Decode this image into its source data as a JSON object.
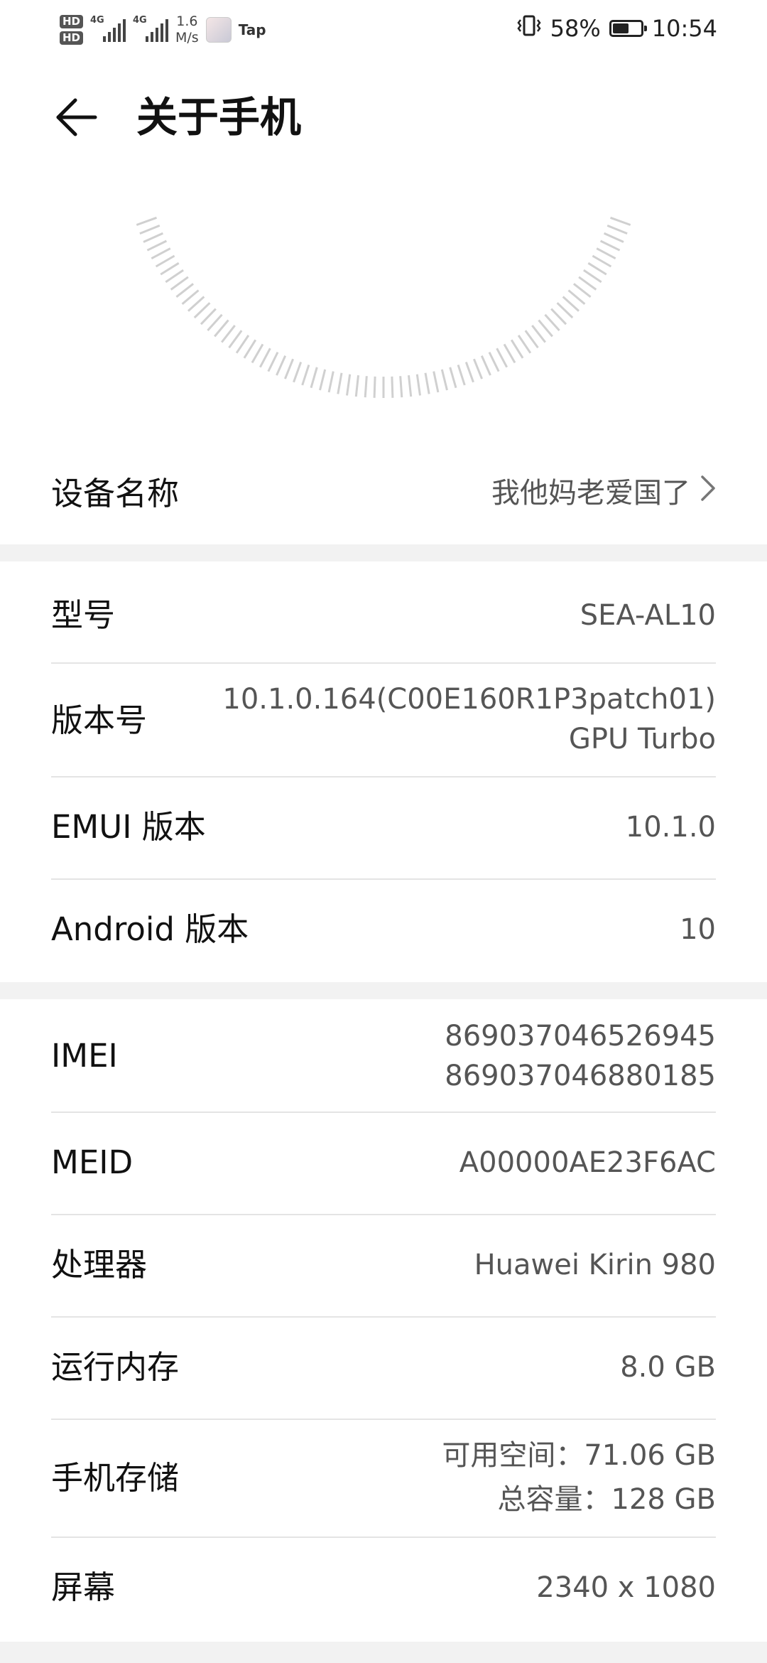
{
  "status": {
    "hd1": "HD",
    "hd2": "HD",
    "net1": "4G",
    "net2": "4G",
    "speed_value": "1.6",
    "speed_unit": "M/s",
    "app_label": "Tap",
    "battery_percent_text": "58%",
    "battery_level": 58,
    "time": "10:54"
  },
  "header": {
    "title": "关于手机"
  },
  "device_name": {
    "label": "设备名称",
    "value": "我他妈老爱国了"
  },
  "section1": [
    {
      "label": "型号",
      "lines": [
        "SEA-AL10"
      ]
    },
    {
      "label": "版本号",
      "lines": [
        "10.1.0.164(C00E160R1P3patch01)",
        "GPU Turbo"
      ]
    },
    {
      "label": "EMUI 版本",
      "lines": [
        "10.1.0"
      ]
    },
    {
      "label": "Android 版本",
      "lines": [
        "10"
      ]
    }
  ],
  "section2": [
    {
      "label": "IMEI",
      "lines": [
        "869037046526945",
        "869037046880185"
      ]
    },
    {
      "label": "MEID",
      "lines": [
        "A00000AE23F6AC"
      ]
    },
    {
      "label": "处理器",
      "lines": [
        "Huawei Kirin 980"
      ]
    },
    {
      "label": "运行内存",
      "lines": [
        "8.0 GB"
      ]
    },
    {
      "label": "手机存储",
      "lines": [
        "可用空间：71.06  GB",
        "总容量：128  GB"
      ]
    },
    {
      "label": "屏幕",
      "lines": [
        "2340 x 1080"
      ]
    }
  ],
  "colors": {
    "divider": "#e4e4e4",
    "section_gap": "#f2f2f2",
    "value_text": "#555555"
  },
  "icons": {
    "back": "back-arrow-icon",
    "chevron": "chevron-right-icon",
    "vibrate": "vibrate-icon",
    "battery": "battery-icon"
  }
}
